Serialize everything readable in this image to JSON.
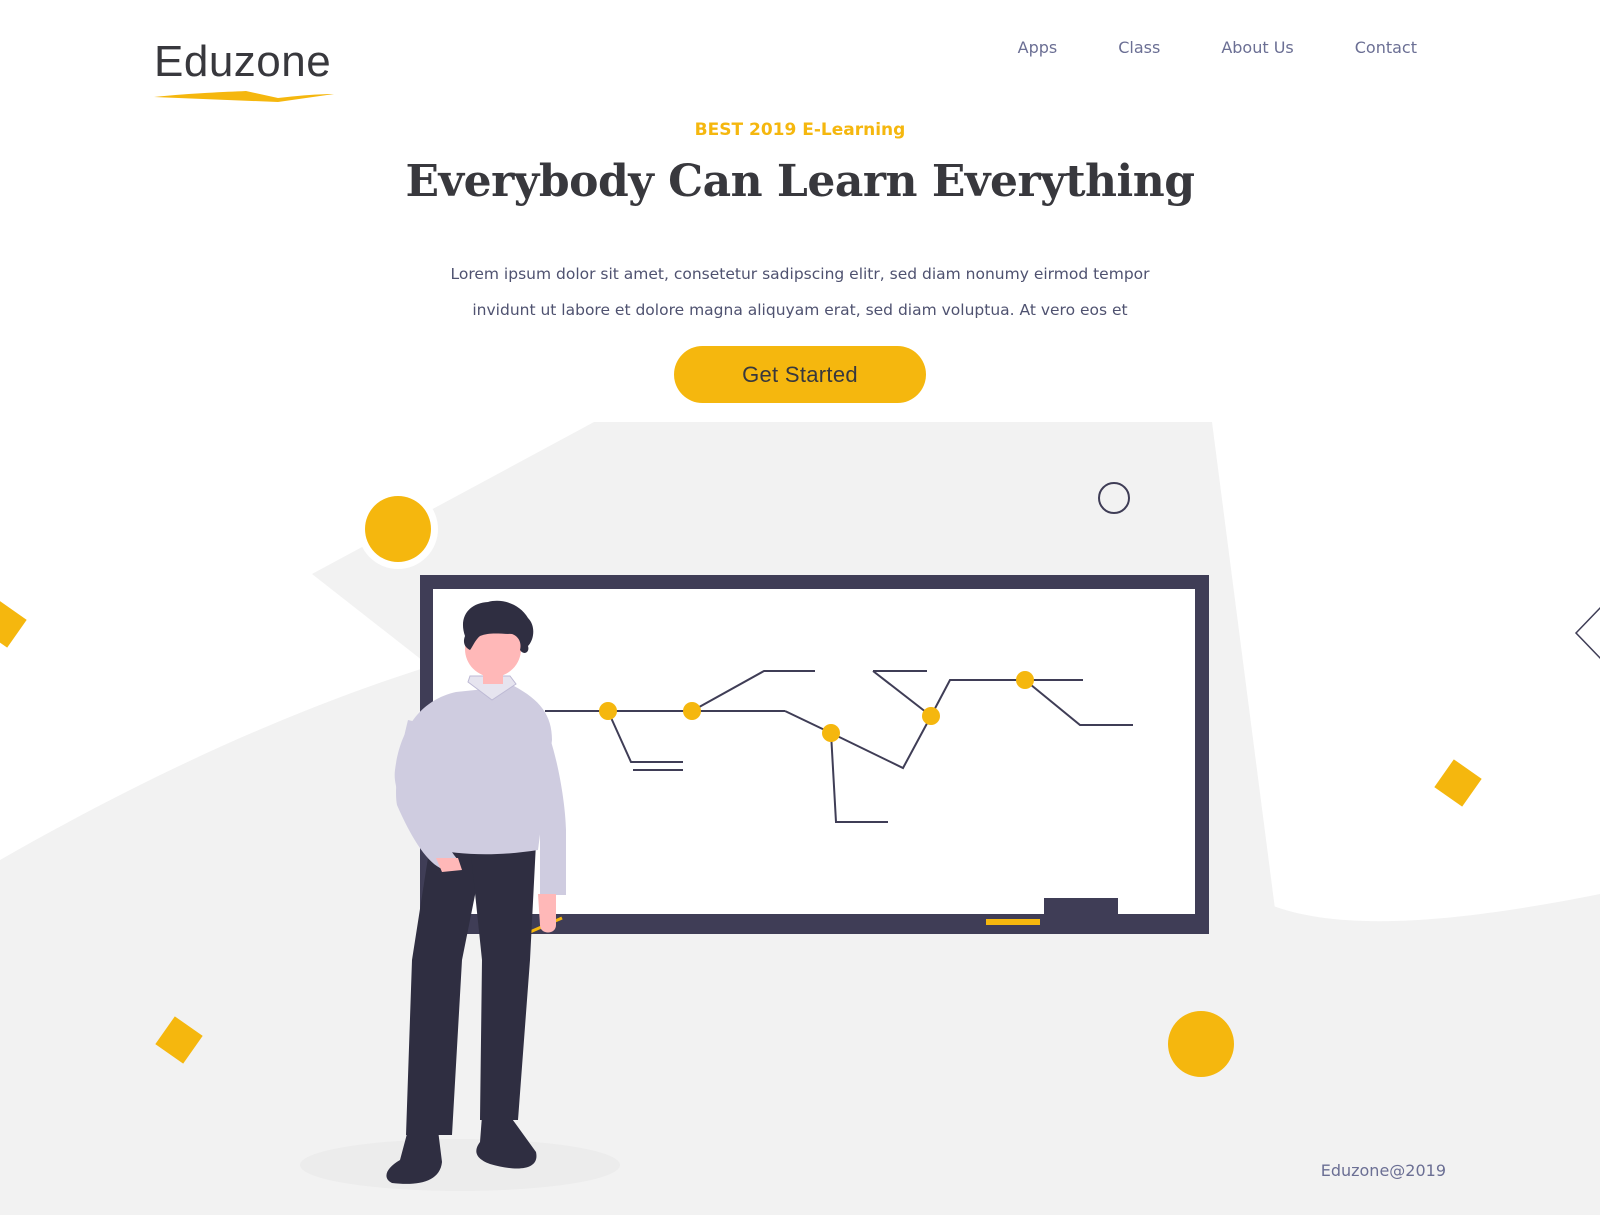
{
  "brand": {
    "name": "Eduzone"
  },
  "nav": {
    "items": [
      {
        "label": "Apps"
      },
      {
        "label": "Class"
      },
      {
        "label": "About Us"
      },
      {
        "label": "Contact"
      }
    ]
  },
  "hero": {
    "eyebrow": "BEST 2019 E-Learning",
    "title": "Everybody Can Learn Everything",
    "description_lines": [
      "Lorem ipsum dolor sit amet, consetetur sadipscing elitr, sed diam nonumy eirmod tempor",
      "invidunt ut labore et dolore magna aliquyam erat, sed diam voluptua. At vero eos et"
    ],
    "cta_label": "Get Started"
  },
  "footer": {
    "copyright": "Eduzone@2019"
  },
  "theme": {
    "accent": "#f5b70e",
    "text_dark": "#38383d",
    "text_muted": "#6b6f94",
    "board_frame": "#3f3d56",
    "background_shape": "#f2f2f2"
  },
  "illustration": {
    "icon": "teacher-at-whiteboard-illustration"
  }
}
